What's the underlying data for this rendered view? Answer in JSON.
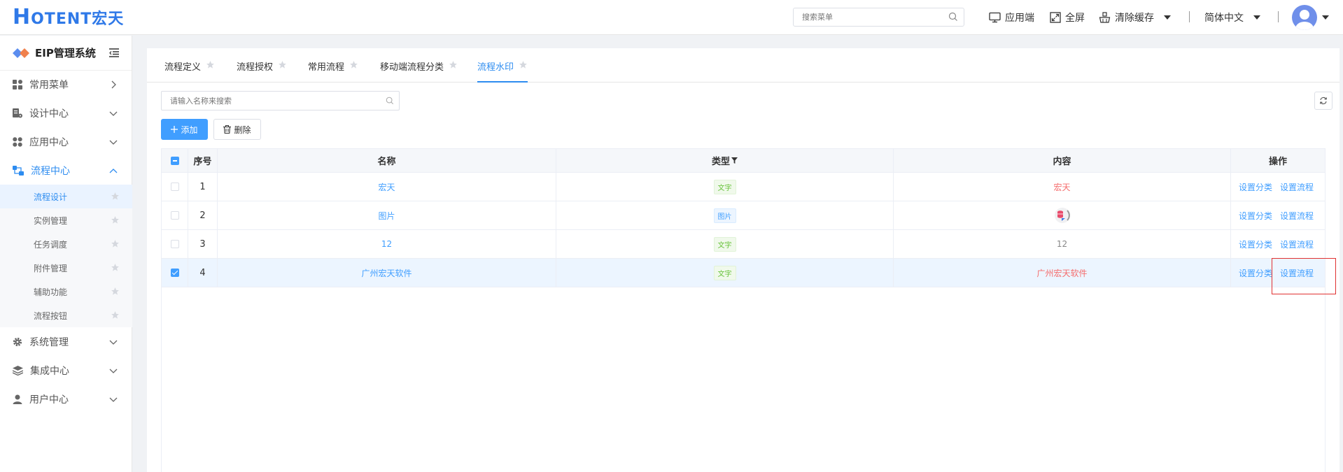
{
  "header": {
    "logo_h": "H",
    "logo_text": "OTENT宏天",
    "search_placeholder": "搜索菜单",
    "app_label": "应用端",
    "fullscreen_label": "全屏",
    "clear_cache_label": "清除缓存",
    "language_label": "简体中文"
  },
  "sidebar": {
    "title": "EIP管理系统",
    "items": [
      {
        "label": "常用菜单"
      },
      {
        "label": "设计中心"
      },
      {
        "label": "应用中心"
      },
      {
        "label": "流程中心"
      },
      {
        "label": "系统管理"
      },
      {
        "label": "集成中心"
      },
      {
        "label": "用户中心"
      }
    ],
    "sub_items": [
      {
        "label": "流程设计"
      },
      {
        "label": "实例管理"
      },
      {
        "label": "任务调度"
      },
      {
        "label": "附件管理"
      },
      {
        "label": "辅助功能"
      },
      {
        "label": "流程按钮"
      }
    ]
  },
  "tabs": [
    {
      "label": "流程定义"
    },
    {
      "label": "流程授权"
    },
    {
      "label": "常用流程"
    },
    {
      "label": "移动端流程分类"
    },
    {
      "label": "流程水印"
    }
  ],
  "toolbar": {
    "search_placeholder": "请输入名称来搜索",
    "add_label": "添加",
    "delete_label": "删除"
  },
  "table": {
    "headers": {
      "index": "序号",
      "name": "名称",
      "type": "类型",
      "content": "内容",
      "ops": "操作"
    },
    "op_category": "设置分类",
    "op_flow": "设置流程",
    "rows": [
      {
        "index": "1",
        "name": "宏天",
        "type": "文字",
        "content": "宏天"
      },
      {
        "index": "2",
        "name": "图片",
        "type": "图片",
        "content": ""
      },
      {
        "index": "3",
        "name": "12",
        "type": "文字",
        "content": "12"
      },
      {
        "index": "4",
        "name": "广州宏天软件",
        "type": "文字",
        "content": "广州宏天软件"
      }
    ]
  },
  "colors": {
    "accent": "#409eff",
    "danger": "#f56c6c",
    "success": "#67c23a"
  }
}
